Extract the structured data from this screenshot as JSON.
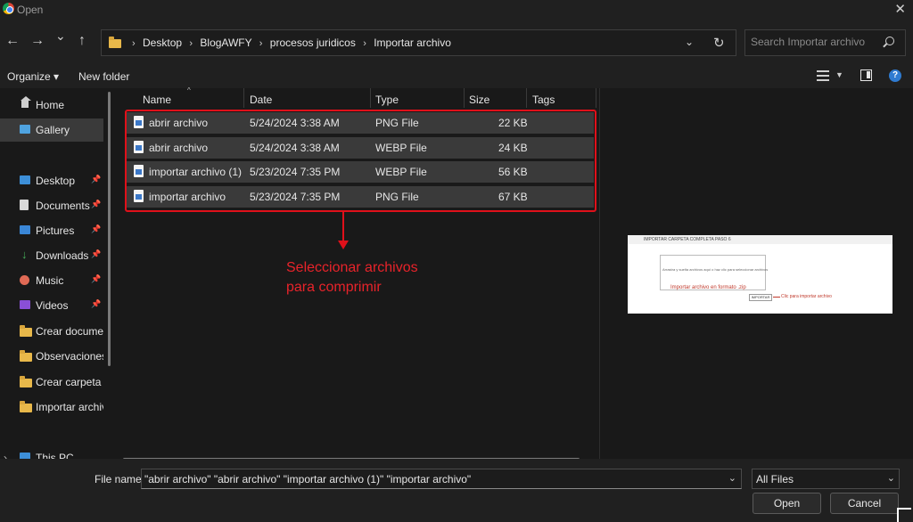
{
  "window": {
    "title": "Open",
    "close_glyph": "✕"
  },
  "nav": {
    "back_glyph": "←",
    "forward_glyph": "→",
    "recent_glyph": "⌄",
    "up_glyph": "↑",
    "breadcrumb": [
      "Desktop",
      "BlogAWFY",
      "procesos juridicos",
      "Importar archivo"
    ],
    "breadcrumb_sep": "›",
    "dropdown_glyph": "⌄",
    "refresh_glyph": "↻",
    "search_placeholder": "Search Importar archivo"
  },
  "commands": {
    "organize": "Organize ▾",
    "new_folder": "New folder",
    "view_drop": "▼",
    "help": "?"
  },
  "sidebar": {
    "pin_glyph": "📌",
    "items": [
      {
        "label": "Home",
        "icon": "home-icon"
      },
      {
        "label": "Gallery",
        "icon": "gallery-icon",
        "selected": true
      },
      {
        "label": "Desktop",
        "icon": "desktop-icon",
        "pinned": true
      },
      {
        "label": "Documents",
        "icon": "documents-icon",
        "pinned": true
      },
      {
        "label": "Pictures",
        "icon": "pictures-icon",
        "pinned": true
      },
      {
        "label": "Downloads",
        "icon": "downloads-icon",
        "pinned": true
      },
      {
        "label": "Music",
        "icon": "music-icon",
        "pinned": true
      },
      {
        "label": "Videos",
        "icon": "videos-icon",
        "pinned": true
      },
      {
        "label": "Crear documentos",
        "icon": "folder-icon"
      },
      {
        "label": "Observaciones",
        "icon": "folder-icon"
      },
      {
        "label": "Crear carpeta",
        "icon": "folder-icon"
      },
      {
        "label": "Importar archivo",
        "icon": "folder-icon"
      },
      {
        "label": "This PC",
        "icon": "this-pc-icon"
      }
    ],
    "expand_glyph": "›"
  },
  "columns": {
    "name": "Name",
    "date": "Date",
    "type": "Type",
    "size": "Size",
    "tags": "Tags",
    "sort_glyph": "^"
  },
  "files": [
    {
      "name": "abrir archivo",
      "date": "5/24/2024 3:38 AM",
      "type": "PNG File",
      "size": "22 KB"
    },
    {
      "name": "abrir archivo",
      "date": "5/24/2024 3:38 AM",
      "type": "WEBP File",
      "size": "24 KB"
    },
    {
      "name": "importar archivo (1)",
      "date": "5/23/2024 7:35 PM",
      "type": "WEBP File",
      "size": "56 KB"
    },
    {
      "name": "importar archivo",
      "date": "5/23/2024 7:35 PM",
      "type": "PNG File",
      "size": "67 KB"
    }
  ],
  "annotation": {
    "text_line1": "Seleccionar archivos",
    "text_line2": "para comprimir",
    "color": "#e0101a"
  },
  "preview": {
    "title": "IMPORTAR CARPETA COMPLETA PASO 6",
    "box_text": "Arrastra y suelta archivos aquí o haz clic para seleccionar archivos",
    "caption": "Importar archivo en formato .zip",
    "button": "IMPORTAR",
    "click_text": "Clic para importar archivo"
  },
  "bottom": {
    "file_name_label": "File name:",
    "file_name_value": "\"abrir archivo\" \"abrir archivo\" \"importar archivo (1)\" \"importar archivo\"",
    "dropdown_glyph": "⌄",
    "file_type": "All Files",
    "open": "Open",
    "cancel": "Cancel"
  }
}
